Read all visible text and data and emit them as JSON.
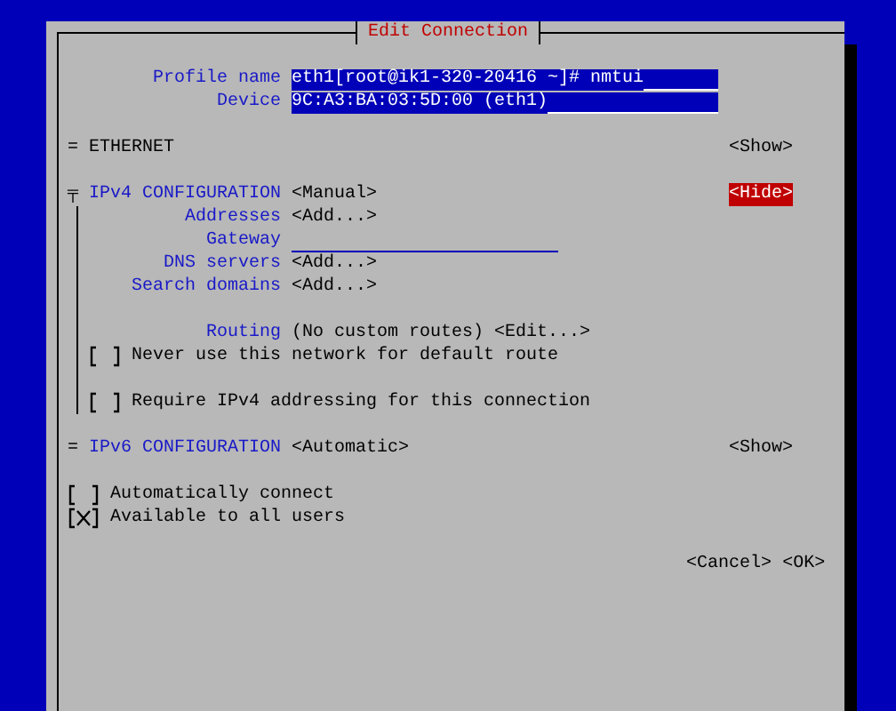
{
  "dialog": {
    "title": "Edit Connection",
    "fields": [
      {
        "label": "Profile name",
        "value": "eth1[root@ik1-320-20416 ~]# nmtui"
      },
      {
        "label": "Device",
        "value": "9C:A3:BA:03:5D:00 (eth1)"
      }
    ],
    "sections": [
      {
        "marker": "=",
        "title": "ETHERNET",
        "toggle": "<Show>",
        "focused": false
      },
      {
        "marker": "╤",
        "title": "IPv4 CONFIGURATION",
        "mode": "<Manual>",
        "toggle": "<Hide>",
        "focused": true,
        "rows": [
          {
            "kind": "list",
            "label": "Addresses",
            "button": "<Add...>"
          },
          {
            "kind": "entry",
            "label": "Gateway"
          },
          {
            "kind": "list",
            "label": "DNS servers",
            "button": "<Add...>"
          },
          {
            "kind": "list",
            "label": "Search domains",
            "button": "<Add...>"
          },
          {
            "kind": "routing",
            "label": "Routing",
            "value": "(No custom routes)",
            "button": "<Edit...>"
          },
          {
            "kind": "checkbox",
            "label": "Never use this network for default route",
            "checked": false
          },
          {
            "kind": "checkbox",
            "label": "Require IPv4 addressing for this connection",
            "checked": false
          }
        ]
      },
      {
        "marker": "=",
        "title": "IPv6 CONFIGURATION",
        "mode": "<Automatic>",
        "toggle": "<Show>",
        "focused": false
      }
    ],
    "options": [
      {
        "label": "Automatically connect",
        "checked": false
      },
      {
        "label": "Available to all users",
        "checked": true
      }
    ],
    "buttons": [
      "<Cancel>",
      "<OK>"
    ]
  }
}
